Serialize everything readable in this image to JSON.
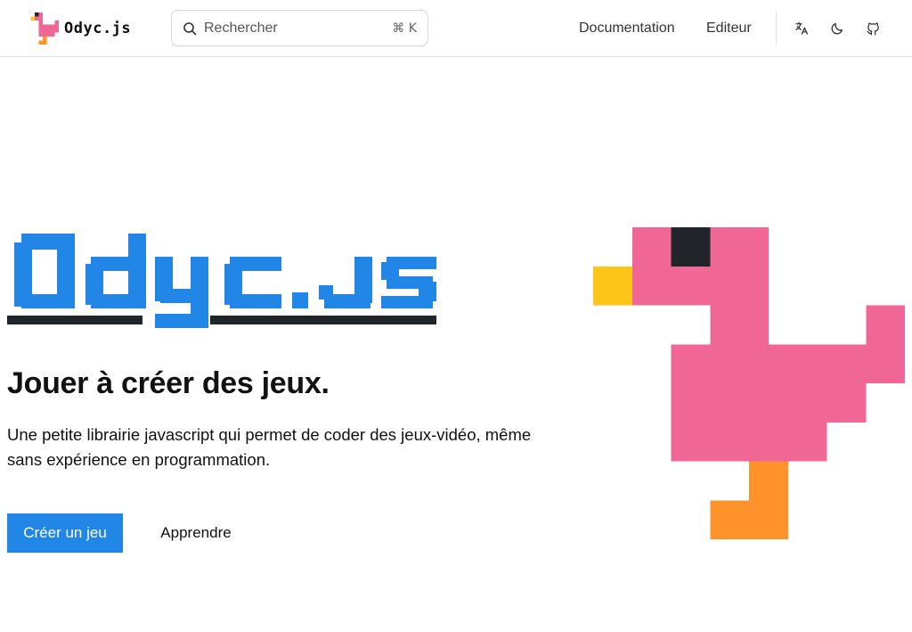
{
  "colors": {
    "brand_pink": "#f06695",
    "brand_blue": "#2186e6",
    "beak_yellow": "#fbc51a",
    "leg_orange": "#ff922b",
    "eye_dark": "#212529",
    "underline_dark": "#212529"
  },
  "header": {
    "brand_name": "Odyc.js",
    "search": {
      "placeholder": "Rechercher",
      "shortcut": "⌘ K"
    },
    "nav": [
      {
        "label": "Documentation"
      },
      {
        "label": "Editeur"
      }
    ],
    "icons": [
      "translate-icon",
      "moon-icon",
      "github-icon"
    ]
  },
  "hero": {
    "logo_text": "Odyc.js",
    "title": "Jouer à créer des jeux.",
    "description": "Une petite librairie javascript qui permet de coder des jeux-vidéo, même sans expérience en programmation.",
    "primary_button": "Créer un jeu",
    "secondary_button": "Apprendre"
  }
}
